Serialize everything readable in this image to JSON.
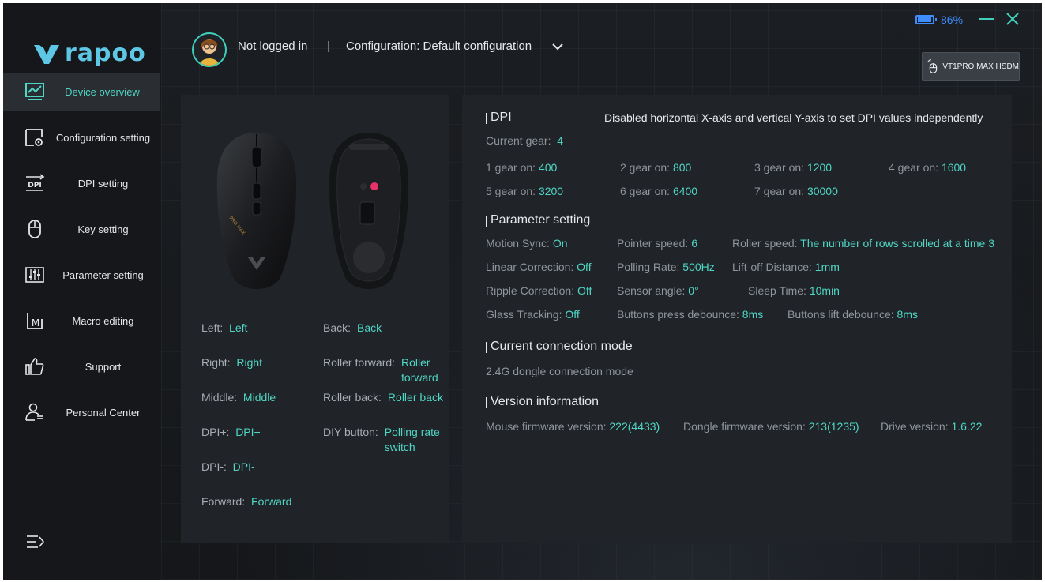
{
  "sidebar": {
    "logo_text": "rapoo",
    "items": [
      {
        "label": "Device overview",
        "icon": "monitor-chart-icon",
        "active": true
      },
      {
        "label": "Configuration setting",
        "icon": "config-gear-icon",
        "active": false
      },
      {
        "label": "DPI setting",
        "icon": "dpi-icon",
        "active": false
      },
      {
        "label": "Key setting",
        "icon": "mouse-icon",
        "active": false
      },
      {
        "label": "Parameter setting",
        "icon": "sliders-icon",
        "active": false
      },
      {
        "label": "Macro editing",
        "icon": "macro-icon",
        "active": false
      },
      {
        "label": "Support",
        "icon": "thumbs-up-icon",
        "active": false
      },
      {
        "label": "Personal Center",
        "icon": "user-icon",
        "active": false
      }
    ]
  },
  "header": {
    "user_status": "Not logged in",
    "separator": "|",
    "config_label": "Configuration: Default configuration",
    "battery_percent": "86%",
    "battery_level": 0.86,
    "device_name": "VT1PRO MAX HSDM"
  },
  "keys": {
    "left_col": [
      {
        "label": "Left:",
        "value": "Left"
      },
      {
        "label": "Right:",
        "value": "Right"
      },
      {
        "label": "Middle:",
        "value": "Middle"
      },
      {
        "label": "DPI+:",
        "value": "DPI+"
      },
      {
        "label": "DPI-:",
        "value": "DPI-"
      },
      {
        "label": "Forward:",
        "value": "Forward"
      }
    ],
    "right_col": [
      {
        "label": "Back:",
        "value": "Back"
      },
      {
        "label": "Roller forward:",
        "value": "Roller forward"
      },
      {
        "label": "Roller back:",
        "value": "Roller back"
      },
      {
        "label": "DIY button:",
        "value": "Polling rate switch"
      }
    ]
  },
  "dpi": {
    "title": "DPI",
    "note": "Disabled horizontal X-axis and vertical Y-axis to set DPI values independently",
    "current_gear_label": "Current gear:",
    "current_gear": "4",
    "gears": [
      {
        "label": "1 gear on:",
        "value": "400"
      },
      {
        "label": "2 gear on:",
        "value": "800"
      },
      {
        "label": "3 gear on:",
        "value": "1200"
      },
      {
        "label": "4 gear on:",
        "value": "1600"
      },
      {
        "label": "5 gear on:",
        "value": "3200"
      },
      {
        "label": "6 gear on:",
        "value": "6400"
      },
      {
        "label": "7 gear on:",
        "value": "30000"
      }
    ]
  },
  "params": {
    "title": "Parameter setting",
    "items": [
      {
        "label": "Motion Sync:",
        "value": "On"
      },
      {
        "label": "Pointer speed:",
        "value": "6"
      },
      {
        "label": "Roller speed:",
        "value": "The number of rows scrolled at a time 3"
      },
      {
        "label": "Linear Correction:",
        "value": "Off"
      },
      {
        "label": "Polling Rate:",
        "value": "500Hz"
      },
      {
        "label": "Lift-off Distance:",
        "value": "1mm"
      },
      {
        "label": "Ripple Correction:",
        "value": "Off"
      },
      {
        "label": "Sensor angle:",
        "value": "0°"
      },
      {
        "label": "Sleep Time:",
        "value": "10min"
      },
      {
        "label": "Glass Tracking:",
        "value": "Off"
      },
      {
        "label": "Buttons press debounce:",
        "value": "8ms"
      },
      {
        "label": "Buttons lift debounce:",
        "value": "8ms"
      }
    ]
  },
  "connection": {
    "title": "Current connection mode",
    "mode": "2.4G dongle connection mode"
  },
  "version": {
    "title": "Version information",
    "items": [
      {
        "label": "Mouse firmware version:",
        "value": "222(4433)"
      },
      {
        "label": "Dongle firmware version:",
        "value": "213(1235)"
      },
      {
        "label": "Drive version:",
        "value": "1.6.22"
      }
    ]
  }
}
